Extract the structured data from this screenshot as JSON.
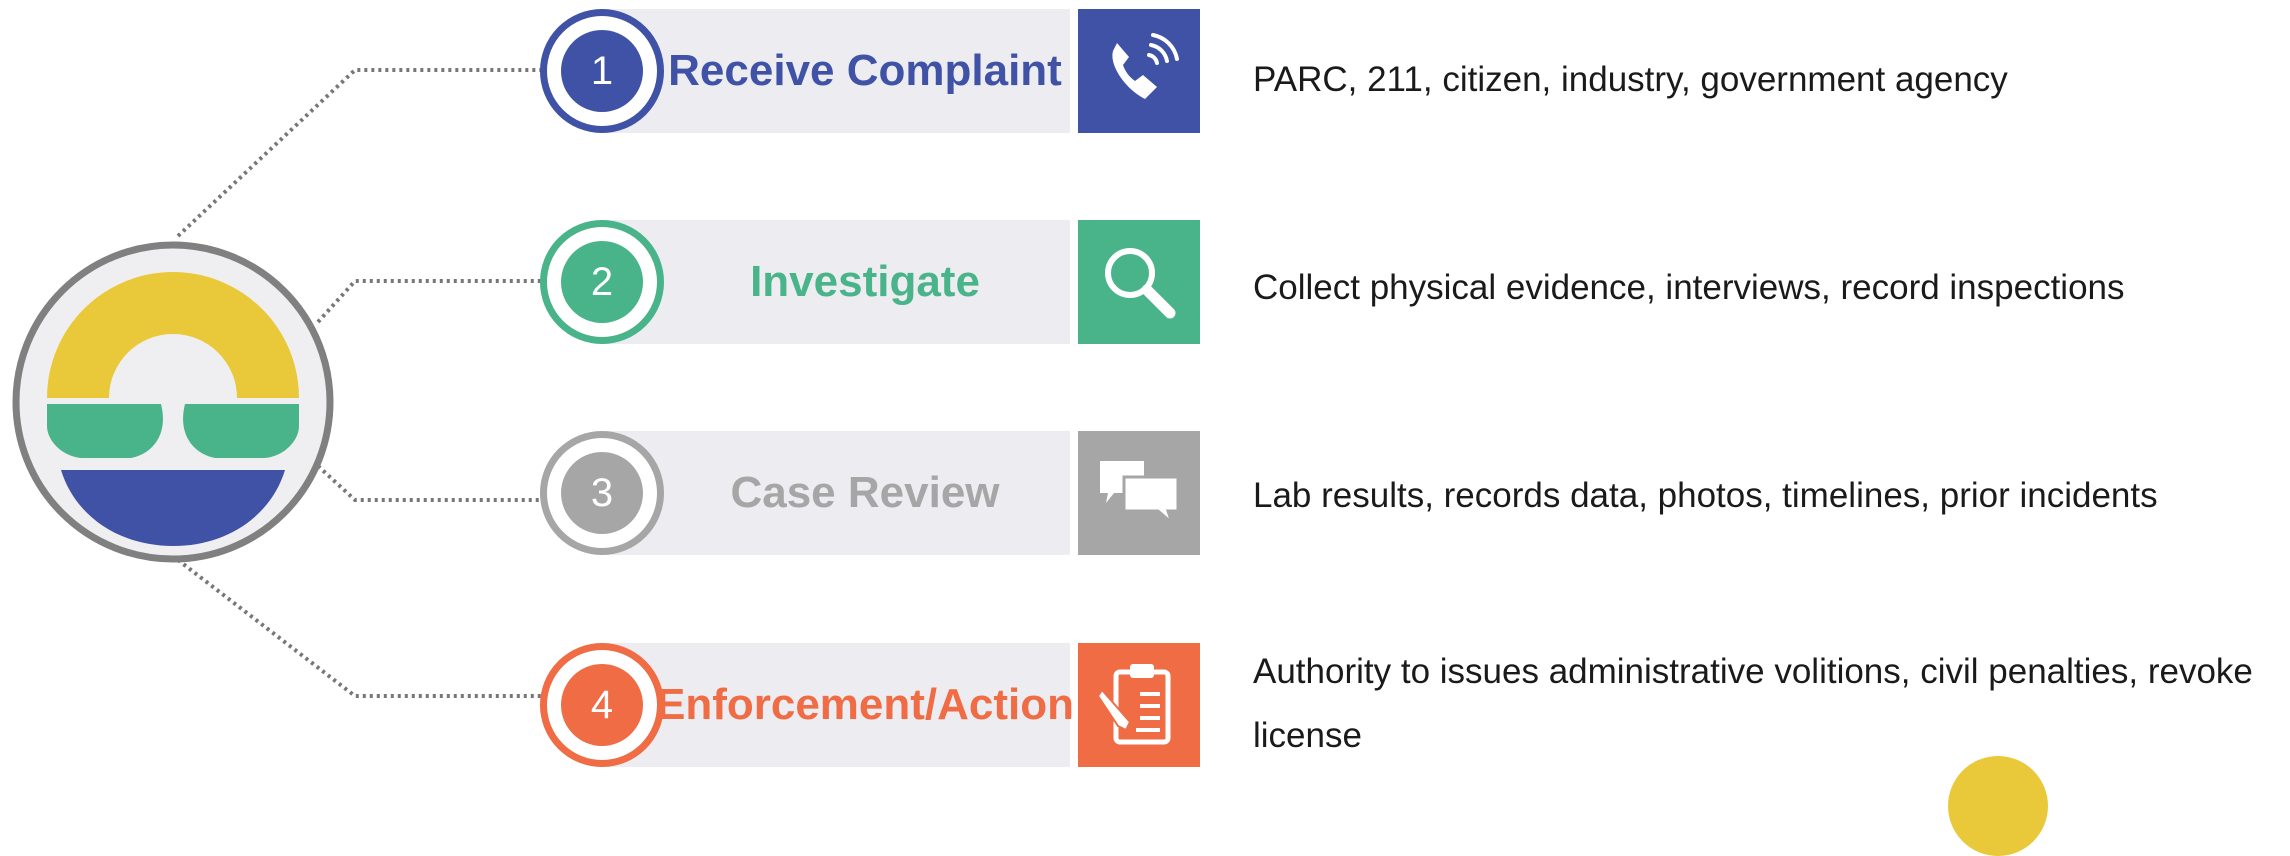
{
  "colors": {
    "blue": "#3f52a6",
    "green": "#49b389",
    "gray": "#a6a6a6",
    "orange": "#ef6c45",
    "yellow": "#e9c93a",
    "band": "#ececf1",
    "connector": "#777777"
  },
  "logo": {
    "icon": "sunrise-water-emblem-icon"
  },
  "steps": [
    {
      "number": "1",
      "title": "Receive Complaint",
      "icon": "phone-icon",
      "description": "PARC, 211, citizen, industry, government agency"
    },
    {
      "number": "2",
      "title": "Investigate",
      "icon": "magnifier-icon",
      "description": "Collect physical evidence, interviews, record inspections"
    },
    {
      "number": "3",
      "title": "Case Review",
      "icon": "chat-bubbles-icon",
      "description": "Lab results, records data, photos, timelines, prior incidents"
    },
    {
      "number": "4",
      "title": "Enforcement/Action",
      "icon": "clipboard-pencil-icon",
      "description": "Authority to issues administrative volitions, civil penalties, revoke license"
    }
  ]
}
